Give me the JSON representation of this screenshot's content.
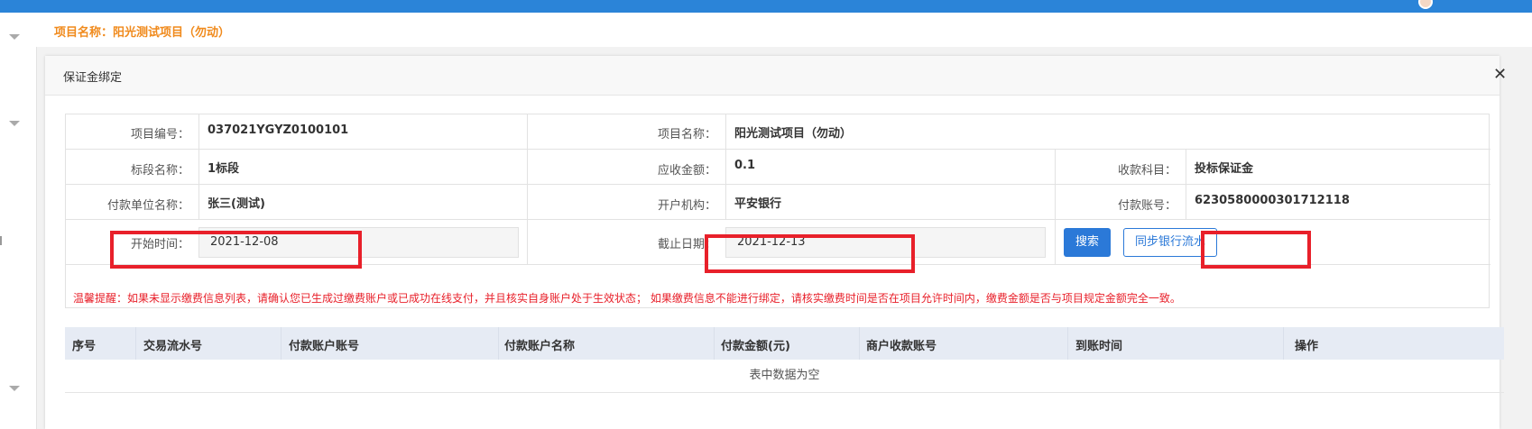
{
  "project_bar": {
    "text": "项目名称：阳光测试项目（勿动）"
  },
  "modal": {
    "title": "保证金绑定",
    "close_symbol": "✕"
  },
  "info": {
    "project_no_label": "项目编号：",
    "project_no_value": "037021YGYZ0100101",
    "project_name_label": "项目名称：",
    "project_name_value": "阳光测试项目（勿动）",
    "section_label": "标段名称：",
    "section_value": "1标段",
    "amount_label": "应收金额：",
    "amount_value": "0.1",
    "subject_label": "收款科目：",
    "subject_value": "投标保证金",
    "payer_label": "付款单位名称：",
    "payer_value": "张三(测试)",
    "bank_label": "开户机构：",
    "bank_value": "平安银行",
    "account_label": "付款账号：",
    "account_value": "6230580000301712118",
    "start_label": "开始时间：",
    "start_value": "2021-12-08",
    "end_label": "截止日期：",
    "end_value": "2021-12-13",
    "search_label": "搜索",
    "sync_label": "同步银行流水",
    "warning": "温馨提醒：如果未显示缴费信息列表，请确认您已生成过缴费账户或已成功在线支付，并且核实自身账户处于生效状态； 如果缴费信息不能进行绑定，请核实缴费时间是否在项目允许时间内，缴费金额是否与项目规定金额完全一致。"
  },
  "table": {
    "headers": [
      "序号",
      "交易流水号",
      "付款账户账号",
      "付款账户名称",
      "付款金额(元)",
      "商户收款账号",
      "到账时间",
      "操作"
    ],
    "empty_text": "表中数据为空"
  },
  "colors": {
    "accent": "#2b79d8",
    "warning": "#e8202a",
    "project": "#f08a1c"
  }
}
